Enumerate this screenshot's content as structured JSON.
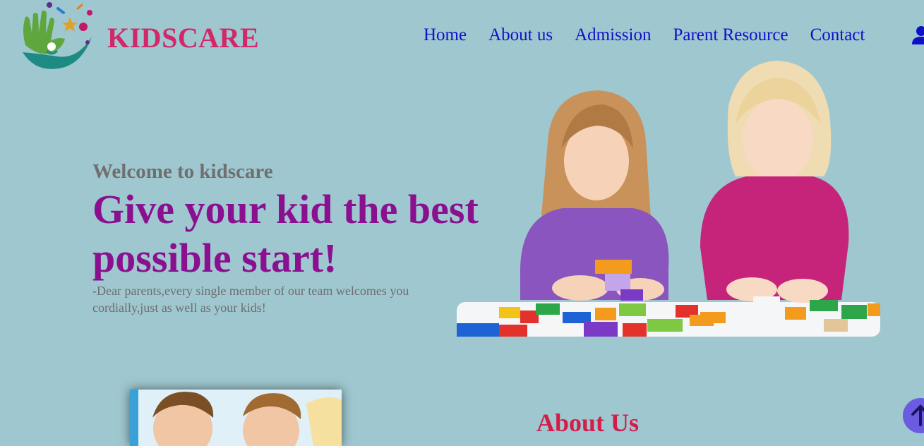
{
  "brand": {
    "name": "KIDSCARE"
  },
  "nav": {
    "items": [
      {
        "label": "Home"
      },
      {
        "label": "About us"
      },
      {
        "label": "Admission"
      },
      {
        "label": "Parent Resource"
      },
      {
        "label": "Contact"
      }
    ]
  },
  "hero": {
    "welcome": "Welcome to kidscare",
    "headline": "Give your kid the best possible start!",
    "subtext": "-Dear parents,every single member of our team welcomes you cordially,just as well as your kids!"
  },
  "about": {
    "title": "About Us"
  },
  "icons": {
    "logo": "kidscare-hand-logo-icon",
    "user": "user-icon",
    "scroll_top": "arrow-up-icon"
  },
  "colors": {
    "background": "#9fc7cf",
    "brand": "#d1286a",
    "nav_link": "#1010c8",
    "headline": "#8a1090",
    "about_title": "#d21d4b",
    "scroll_button": "#6a5be0"
  }
}
